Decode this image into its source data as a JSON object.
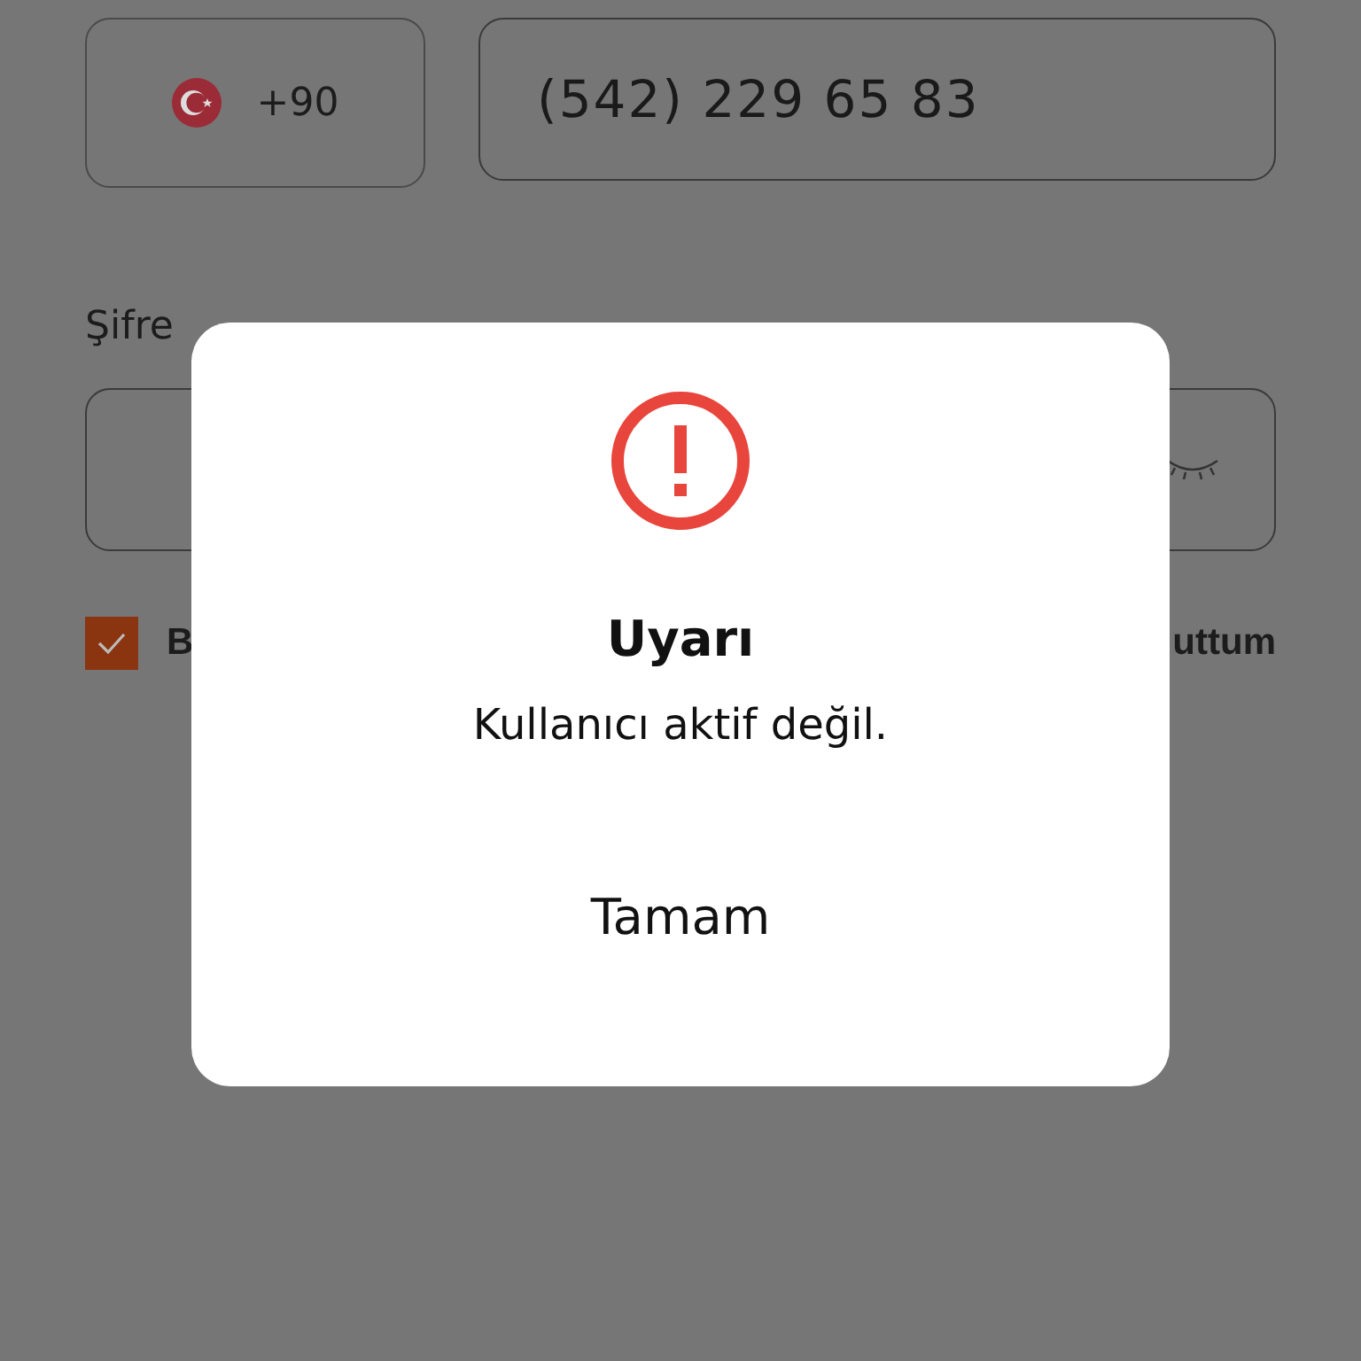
{
  "phone": {
    "country_code": "+90",
    "number": "(542) 229 65 83"
  },
  "password": {
    "label": "Şifre"
  },
  "consent": {
    "checked": true,
    "text_start": "B",
    "text_end": "uttum"
  },
  "dialog": {
    "title": "Uyarı",
    "message": "Kullanıcı aktif değil.",
    "button": "Tamam"
  }
}
